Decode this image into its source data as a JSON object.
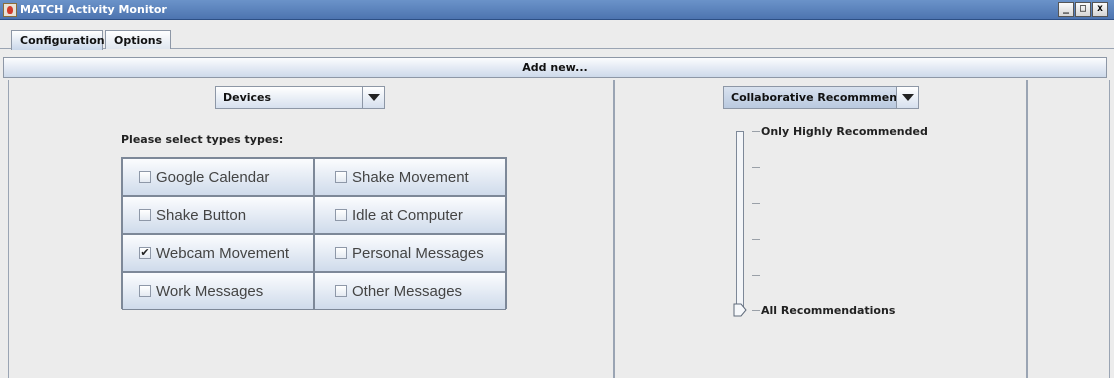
{
  "window": {
    "title": "MATCH Activity Monitor",
    "buttons": {
      "minimize": "_",
      "maximize": "□",
      "close": "x"
    }
  },
  "tabs": [
    {
      "label": "Configuration",
      "active": true
    },
    {
      "label": "Options",
      "active": false
    }
  ],
  "add_new_button": "Add new...",
  "left_panel": {
    "type_select": {
      "value": "Devices"
    },
    "prompt": "Please select types types:",
    "types": [
      {
        "label": "Google Calendar",
        "checked": false
      },
      {
        "label": "Shake Movement",
        "checked": false
      },
      {
        "label": "Shake Button",
        "checked": false
      },
      {
        "label": "Idle at Computer",
        "checked": false
      },
      {
        "label": "Webcam Movement",
        "checked": true
      },
      {
        "label": "Personal Messages",
        "checked": false
      },
      {
        "label": "Work Messages",
        "checked": false
      },
      {
        "label": "Other Messages",
        "checked": false
      }
    ]
  },
  "right_panel": {
    "recommender_select": {
      "value": "Collaborative Recommmender"
    },
    "slider": {
      "top_label": "Only Highly Recommended",
      "bottom_label": "All Recommendations",
      "level": 0
    }
  },
  "icons": {
    "app": "app-icon",
    "dropdown": "chevron-down-icon",
    "checkbox": "checkbox-icon",
    "slider_thumb": "slider-thumb-icon"
  },
  "colors": {
    "titlebar": "#5a82bd",
    "button_gradient_bottom": "#cfdbeb",
    "window_bg": "#ececec"
  }
}
